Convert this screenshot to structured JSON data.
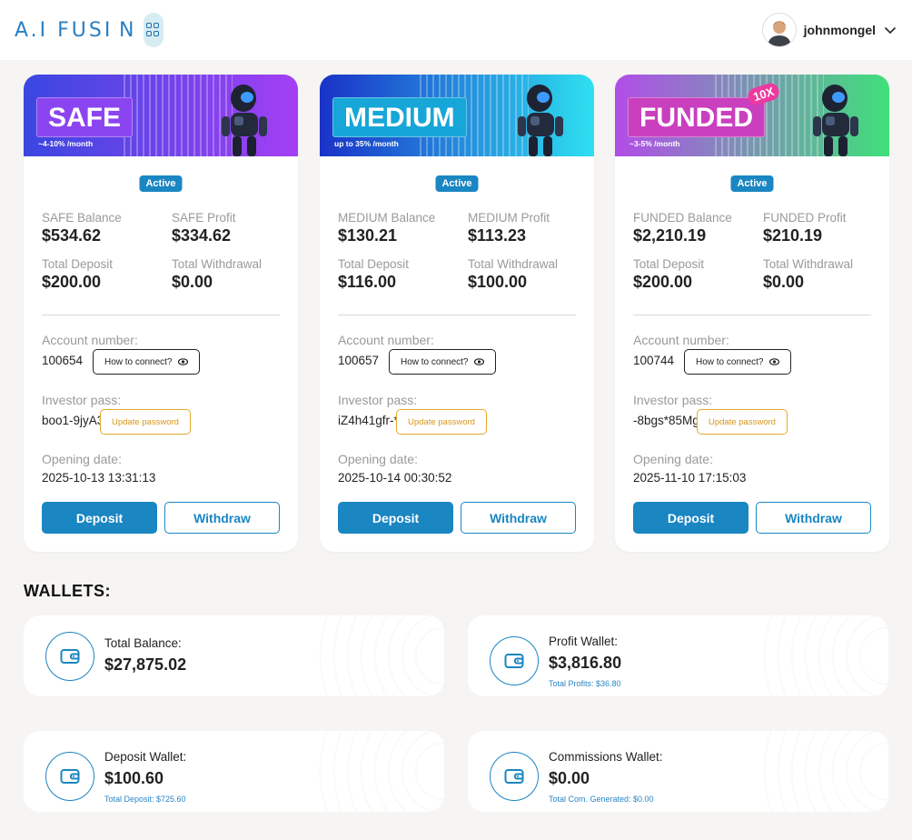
{
  "header": {
    "logo_text": "A.I FUSI N",
    "username": "johnmongel"
  },
  "plans": [
    {
      "name": "SAFE",
      "rate": "~4-10% /month",
      "status": "Active",
      "balance_label": "SAFE Balance",
      "balance": "$534.62",
      "profit_label": "SAFE Profit",
      "profit": "$334.62",
      "deposit_label": "Total Deposit",
      "deposit": "$200.00",
      "withdrawal_label": "Total Withdrawal",
      "withdrawal": "$0.00",
      "account_label": "Account number:",
      "account": "100654",
      "connect_label": "How to connect?",
      "pass_label": "Investor pass:",
      "pass": "boo1-9jyA3",
      "update_label": "Update password",
      "opening_label": "Opening date:",
      "opening": "2025-10-13 13:31:13",
      "deposit_button": "Deposit",
      "withdraw_button": "Withdraw",
      "colors": {
        "banner_start": "#3a47e0",
        "banner_end": "#a43ff4",
        "tag": "#8b45f0"
      }
    },
    {
      "name": "MEDIUM",
      "rate": "up to 35% /month",
      "status": "Active",
      "balance_label": "MEDIUM Balance",
      "balance": "$130.21",
      "profit_label": "MEDIUM Profit",
      "profit": "$113.23",
      "deposit_label": "Total Deposit",
      "deposit": "$116.00",
      "withdrawal_label": "Total Withdrawal",
      "withdrawal": "$100.00",
      "account_label": "Account number:",
      "account": "100657",
      "connect_label": "How to connect?",
      "pass_label": "Investor pass:",
      "pass": "iZ4h41gfr-*",
      "update_label": "Update password",
      "opening_label": "Opening date:",
      "opening": "2025-10-14 00:30:52",
      "deposit_button": "Deposit",
      "withdraw_button": "Withdraw",
      "colors": {
        "banner_start": "#1a32c8",
        "banner_end": "#2ee0f0",
        "tag": "#17a6d8"
      }
    },
    {
      "name": "FUNDED",
      "rate": "~3-5% /month",
      "badge_extra": "10X",
      "status": "Active",
      "balance_label": "FUNDED Balance",
      "balance": "$2,210.19",
      "profit_label": "FUNDED Profit",
      "profit": "$210.19",
      "deposit_label": "Total Deposit",
      "deposit": "$200.00",
      "withdrawal_label": "Total Withdrawal",
      "withdrawal": "$0.00",
      "account_label": "Account number:",
      "account": "100744",
      "connect_label": "How to connect?",
      "pass_label": "Investor pass:",
      "pass": "-8bgs*85Mg",
      "update_label": "Update password",
      "opening_label": "Opening date:",
      "opening": "2025-11-10 17:15:03",
      "deposit_button": "Deposit",
      "withdraw_button": "Withdraw",
      "colors": {
        "banner_start": "#b24de8",
        "banner_end": "#3fe07a",
        "tag": "#c93fbe"
      }
    }
  ],
  "wallets": {
    "title": "WALLETS:",
    "items": [
      {
        "label": "Total Balance:",
        "value": "$27,875.02",
        "sub": ""
      },
      {
        "label": "Profit Wallet:",
        "value": "$3,816.80",
        "sub": "Total Profits: $36.80"
      },
      {
        "label": "Deposit Wallet:",
        "value": "$100.60",
        "sub": "Total Deposit: $725.60"
      },
      {
        "label": "Commissions Wallet:",
        "value": "$0.00",
        "sub": "Total Com. Generated: $0.00"
      }
    ]
  },
  "icons": {
    "wallet": "wallet-icon",
    "eye": "eye-icon",
    "chevron": "chevron-down-icon",
    "avatar": "avatar"
  }
}
